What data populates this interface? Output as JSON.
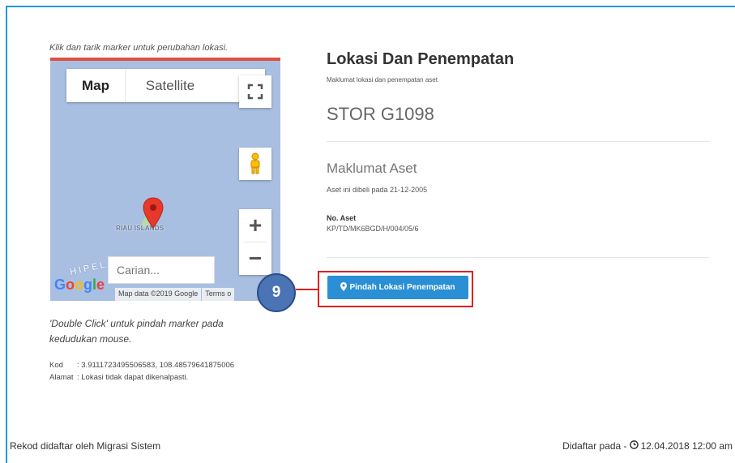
{
  "map_hint": "Klik dan tarik marker untuk perubahan lokasi.",
  "map": {
    "type_map_label": "Map",
    "type_satellite_label": "Satellite",
    "island_label": "RIAU ISLANDS",
    "archipelago_label": "HIPEL",
    "search_placeholder": "Carian...",
    "logo_text": "Google",
    "attribution": "Map data ©2019 Google",
    "terms_label": "Terms o",
    "zoom_in_label": "+",
    "zoom_out_label": "−"
  },
  "double_click_hint": "'Double Click' untuk pindah marker pada kedudukan mouse.",
  "coords": {
    "kod_label": "Kod",
    "kod_value": ": 3.9111723495506583, 108.48579641875006",
    "alamat_label": "Alamat",
    "alamat_value": ": Lokasi tidak dapat dikenalpasti."
  },
  "panel": {
    "title": "Lokasi Dan Penempatan",
    "subtitle": "Maklumat lokasi dan penempatan aset",
    "location": "STOR G1098",
    "section_title": "Maklumat Aset",
    "purchase_text": "Aset ini dibeli pada 21-12-2005",
    "asset_no_label": "No. Aset",
    "asset_no_value": "KP/TD/MK6BGD/H/004/05/6",
    "relocate_button": "Pindah Lokasi Penempatan"
  },
  "step_badge": "9",
  "footer": {
    "left": "Rekod didaftar oleh Migrasi Sistem",
    "right_label": "Didaftar pada -",
    "right_value": "12.04.2018 12:00 am"
  },
  "colors": {
    "frame": "#1a9ad8",
    "button": "#2a8fd4",
    "highlight": "#e02020",
    "badge": "#4a74b4"
  }
}
